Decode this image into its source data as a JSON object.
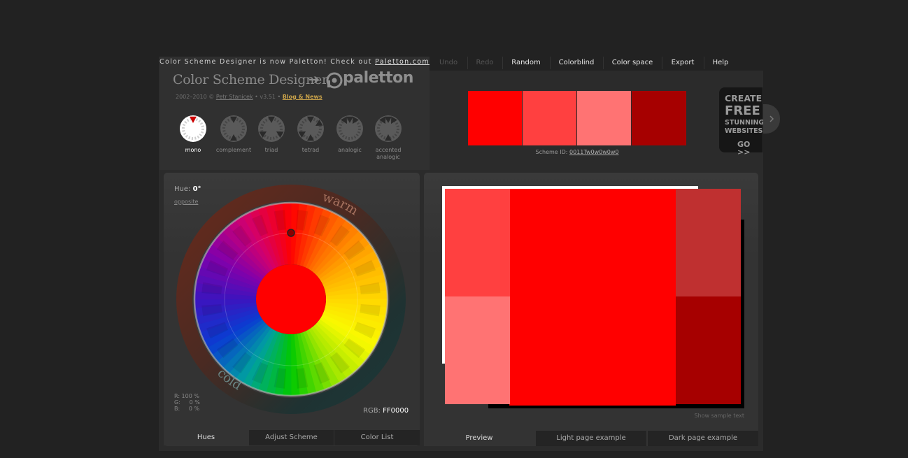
{
  "header": {
    "announcement_prefix": "Color Scheme Designer is now Paletton! Check out ",
    "announcement_link": "Paletton.com",
    "logo_text": "Color Scheme Designer",
    "logo_arrow": "➔",
    "logo_brand": "paletton",
    "copyright_prefix": "2002–2010 ©",
    "author": "Petr Stanicek",
    "version": "• v3.51 •",
    "blog_link": "Blog & News"
  },
  "schemes": [
    {
      "label": "mono",
      "selected": true
    },
    {
      "label": "complement",
      "selected": false
    },
    {
      "label": "triad",
      "selected": false
    },
    {
      "label": "tetrad",
      "selected": false
    },
    {
      "label": "analogic",
      "selected": false
    },
    {
      "label": "accented",
      "label2": "analogic",
      "selected": false
    }
  ],
  "menu": {
    "undo": "Undo",
    "redo": "Redo",
    "random": "Random",
    "colorblind": "Colorblind",
    "colorspace": "Color space",
    "export": "Export",
    "help": "Help"
  },
  "palette": {
    "swatches": [
      "#FF0000",
      "#FF4040",
      "#FF7373",
      "#A60000"
    ],
    "scheme_id_label": "Scheme ID:",
    "scheme_id": "0011Tw0w0w0w0"
  },
  "ad": {
    "line1": "CREATE",
    "line2": "FREE",
    "line3": "STUNNING",
    "line4": "WEBSITES",
    "cta": "GO >>",
    "tab_icon": "chevron-right-icon"
  },
  "wheel": {
    "hue_label": "Hue:",
    "hue_value": "0°",
    "opposite": "opposite",
    "warm": "warm",
    "cold": "cold",
    "r": "R: 100 %",
    "g": "G:     0 %",
    "b": "B:     0 %",
    "rgb_label": "RGB:",
    "rgb_value": "FF0000",
    "center_color": "#FF0000"
  },
  "left_tabs": [
    "Hues",
    "Adjust Scheme",
    "Color List"
  ],
  "right_tabs": [
    "Preview",
    "Light page example",
    "Dark page example"
  ],
  "preview": {
    "colors": {
      "primary": "#FF0000",
      "light1": "#FF4040",
      "light2": "#FF7373",
      "dark1": "#BF3030",
      "dark2": "#A60000",
      "frame": "#FFFFFF",
      "shadow": "#000000"
    },
    "show_sample_text": "Show sample text"
  }
}
